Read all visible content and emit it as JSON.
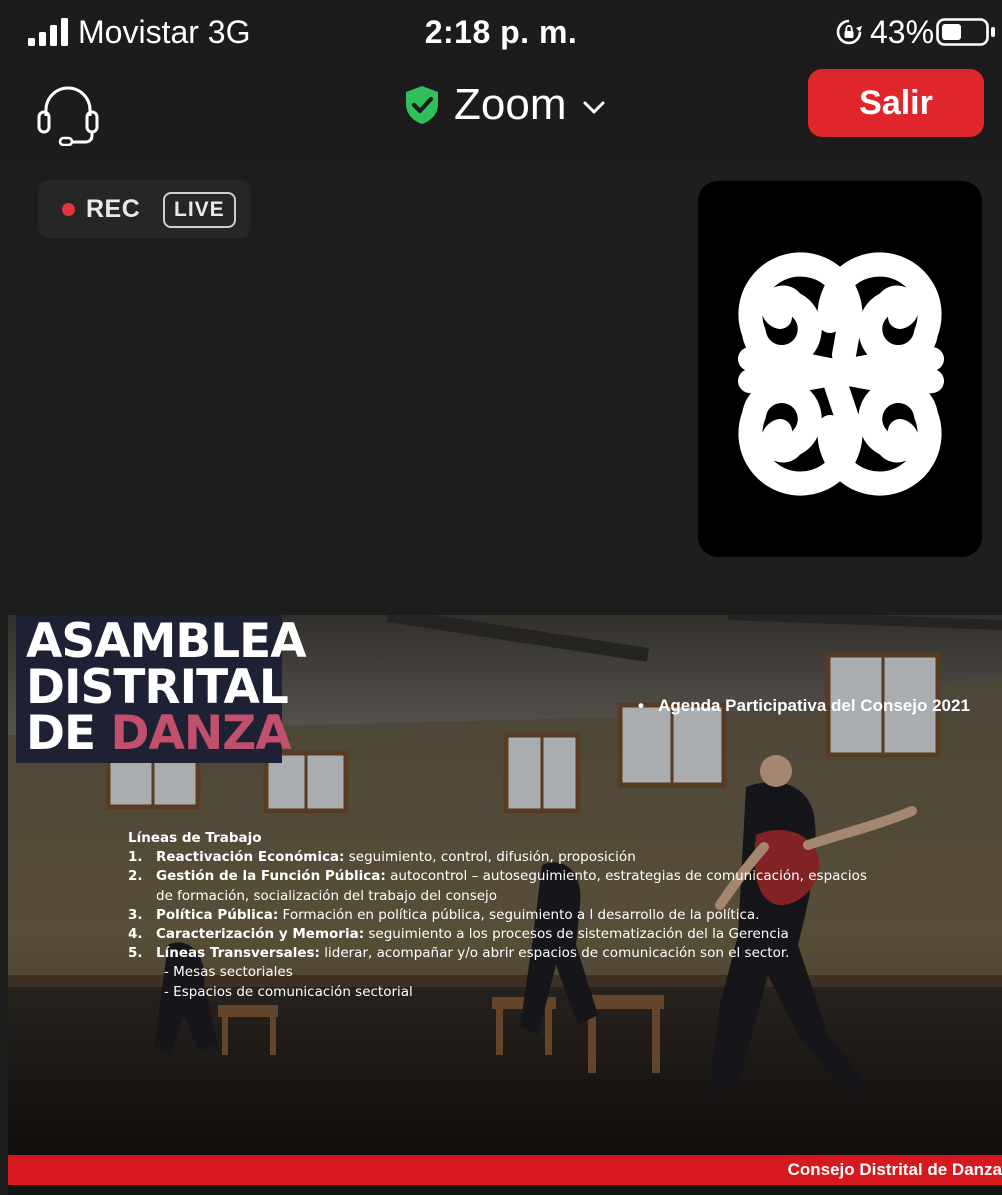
{
  "status_bar": {
    "carrier": "Movistar  3G",
    "time": "2:18 p. m.",
    "battery": "43%",
    "icons": [
      "signal-bars-icon",
      "rotation-lock-icon",
      "battery-icon"
    ]
  },
  "header": {
    "title": "Zoom",
    "exit_label": "Salir",
    "icons": [
      "headset-icon",
      "encryption-shield-icon",
      "chevron-down-icon"
    ],
    "colors": {
      "exit_button": "#e0262d",
      "shield": "#2fbf5b"
    }
  },
  "recording": {
    "rec_label": "REC",
    "live_label": "LIVE",
    "colors": {
      "rec_dot": "#e2343a"
    }
  },
  "participant": {
    "icon": "spiral-symbol-logo"
  },
  "shared_screen": {
    "brand": {
      "line1": "ASAMBLEA",
      "line2": "DISTRITAL",
      "line3_prefix": "DE ",
      "line3_accent": "DANZA",
      "colors": {
        "box": "#1e2134",
        "accent": "#c0506b"
      }
    },
    "agenda": "Agenda Participativa del Consejo 2021",
    "heading": "Líneas de Trabajo",
    "items": [
      {
        "num": "1.",
        "title": "Reactivación Económica:",
        "text": "  seguimiento, control, difusión, proposición"
      },
      {
        "num": "2.",
        "title": "Gestión de la Función Pública:",
        "text": " autocontrol – autoseguimiento, estrategias de comunicación, espacios de formación, socialización del trabajo del consejo"
      },
      {
        "num": "3.",
        "title": "Política Pública:",
        "text": " Formación en política pública, seguimiento a l desarrollo de la política."
      },
      {
        "num": "4.",
        "title": "Caracterización y Memoria:",
        "text": " seguimiento a los procesos de sistematización del la Gerencia"
      },
      {
        "num": "5.",
        "title": "Líneas Transversales:",
        "text": "  liderar, acompañar y/o abrir espacios de comunicación son el sector."
      }
    ],
    "subitems": [
      "- Mesas sectoriales",
      "- Espacios de comunicación sectorial"
    ],
    "footer": "Consejo Distrital de Danza",
    "colors": {
      "footer_bar": "#d5191f"
    }
  }
}
